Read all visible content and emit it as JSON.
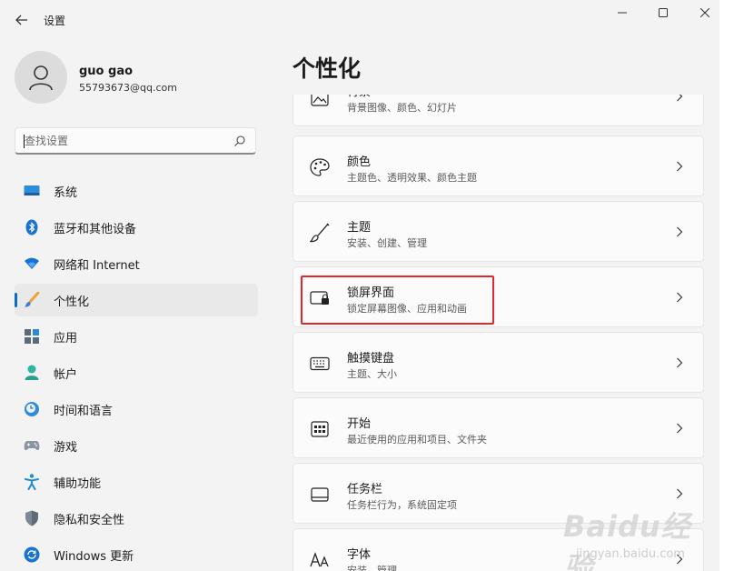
{
  "window": {
    "title": "设置"
  },
  "profile": {
    "name": "guo gao",
    "email": "55793673@qq.com"
  },
  "search": {
    "placeholder": "查找设置"
  },
  "nav": {
    "items": [
      {
        "label": "系统",
        "icon": "system-icon"
      },
      {
        "label": "蓝牙和其他设备",
        "icon": "bluetooth-icon"
      },
      {
        "label": "网络和 Internet",
        "icon": "network-icon"
      },
      {
        "label": "个性化",
        "icon": "personalization-brush-icon",
        "active": true
      },
      {
        "label": "应用",
        "icon": "apps-icon"
      },
      {
        "label": "帐户",
        "icon": "account-icon"
      },
      {
        "label": "时间和语言",
        "icon": "time-language-icon"
      },
      {
        "label": "游戏",
        "icon": "gaming-icon"
      },
      {
        "label": "辅助功能",
        "icon": "accessibility-icon"
      },
      {
        "label": "隐私和安全性",
        "icon": "privacy-shield-icon"
      },
      {
        "label": "Windows 更新",
        "icon": "windows-update-icon"
      }
    ]
  },
  "main": {
    "title": "个性化",
    "cards": [
      {
        "title": "背景",
        "subtitle": "背景图像、颜色、幻灯片",
        "icon": "background-image-icon"
      },
      {
        "title": "颜色",
        "subtitle": "主题色、透明效果、颜色主题",
        "icon": "palette-icon"
      },
      {
        "title": "主题",
        "subtitle": "安装、创建、管理",
        "icon": "theme-brush-icon"
      },
      {
        "title": "锁屏界面",
        "subtitle": "锁定屏幕图像、应用和动画",
        "icon": "lock-screen-icon"
      },
      {
        "title": "触摸键盘",
        "subtitle": "主题、大小",
        "icon": "keyboard-icon"
      },
      {
        "title": "开始",
        "subtitle": "最近使用的应用和项目、文件夹",
        "icon": "start-icon"
      },
      {
        "title": "任务栏",
        "subtitle": "任务栏行为，系统固定项",
        "icon": "taskbar-icon"
      },
      {
        "title": "字体",
        "subtitle": "安装、管理",
        "icon": "fonts-icon"
      }
    ]
  },
  "watermark": {
    "main": "Baidu经验",
    "sub": "jingyan.baidu.com"
  },
  "colors": {
    "accent": "#0a6bc9",
    "highlight": "#e0282e",
    "background": "#f3f3f3",
    "card": "#fbfbfb"
  }
}
